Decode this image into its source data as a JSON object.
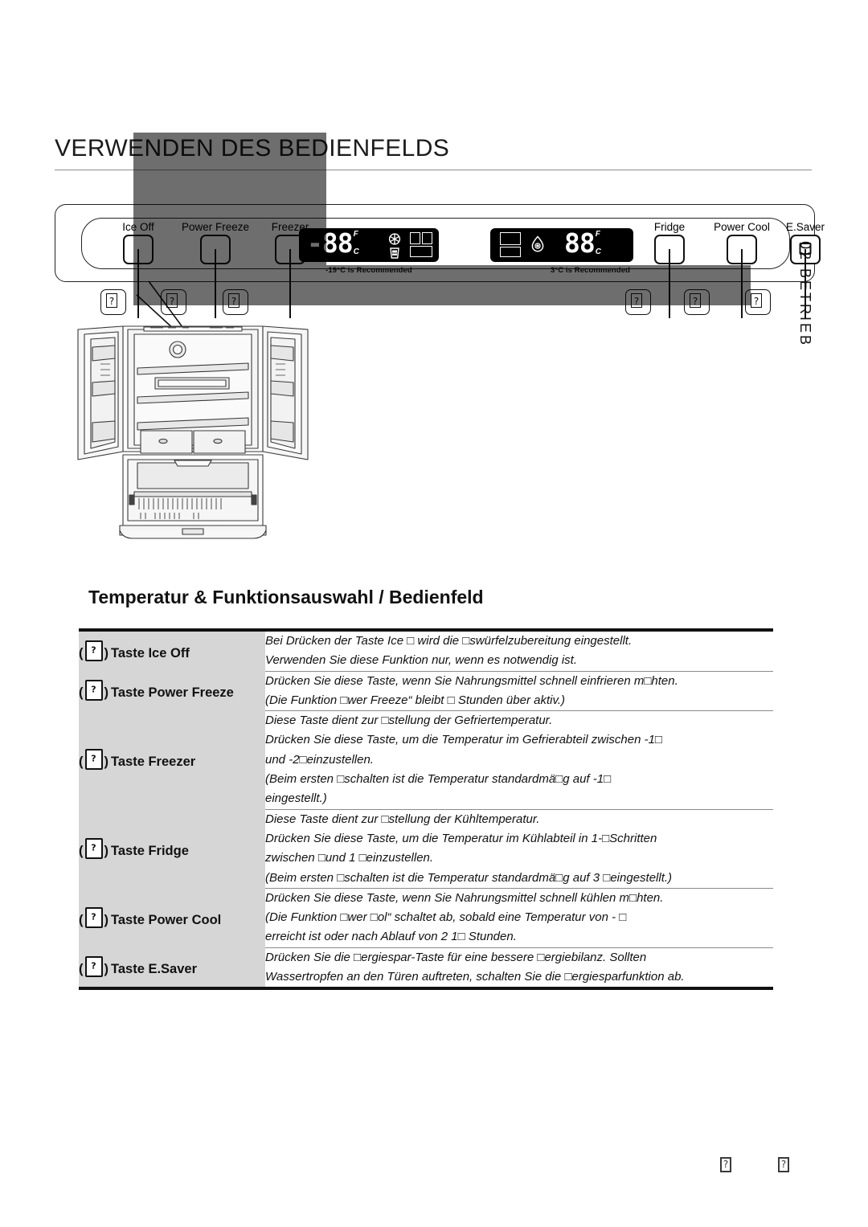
{
  "header": {
    "title": "VERWENDEN DES BEDIENFELDS"
  },
  "side_tab": {
    "number": "02",
    "label": "BETRIEB",
    "text": "02  BETRIEB"
  },
  "control_panel": {
    "left_buttons": [
      {
        "name": "ice-off",
        "label": "Ice Off"
      },
      {
        "name": "power-freeze",
        "label": "Power Freeze"
      },
      {
        "name": "freezer",
        "label": "Freezer"
      }
    ],
    "right_buttons": [
      {
        "name": "fridge",
        "label": "Fridge"
      },
      {
        "name": "power-cool",
        "label": "Power Cool"
      },
      {
        "name": "e-saver",
        "label": "E.Saver"
      }
    ],
    "freezer_display": {
      "value": "-88",
      "unit_f": "F",
      "unit_c": "C",
      "recommend": "-19°C is Recommended",
      "icons": [
        "snowflake-icon",
        "ice-off-icon",
        "compartment-icon"
      ]
    },
    "fridge_display": {
      "value": "88",
      "unit_f": "F",
      "unit_c": "C",
      "recommend": "3°C is Recommended",
      "icons": [
        "compartment-icon",
        "water-drop-icon"
      ]
    },
    "callout_glyph": "?"
  },
  "illustration": {
    "name": "french-door-refrigerator-open"
  },
  "section": {
    "heading": "Temperatur & Funktionsauswahl / Bedienfeld"
  },
  "table": {
    "glyph": "?",
    "rows": [
      {
        "key_line1": "Taste Ice Off",
        "key_line2": "",
        "lines": [
          "Bei Drücken der Taste Ice □ wird die □swürfelzubereitung eingestellt.",
          "Verwenden Sie diese Funktion nur, wenn es notwendig ist."
        ]
      },
      {
        "key_line1": "Taste Power",
        "key_line2": "Freeze",
        "lines": [
          "Drücken Sie diese Taste, wenn Sie Nahrungsmittel schnell einfrieren m□hten.",
          "(Die Funktion □wer Freeze“ bleibt □ Stunden über aktiv.)"
        ]
      },
      {
        "key_line1": "Taste Freezer",
        "key_line2": "",
        "lines": [
          "Diese Taste dient zur □stellung der Gefriertemperatur.",
          "Drücken Sie diese Taste, um die Temperatur im Gefrierabteil zwischen -1□",
          "und -2□einzustellen.",
          "(Beim ersten □schalten ist die Temperatur standardmä□g auf -1□",
          "eingestellt.)"
        ]
      },
      {
        "key_line1": "Taste Fridge",
        "key_line2": "",
        "lines": [
          "Diese Taste dient zur □stellung der Kühltemperatur.",
          "Drücken Sie diese Taste, um die Temperatur im Kühlabteil in 1-□Schritten",
          "zwischen □und 1 □einzustellen.",
          "(Beim ersten □schalten ist die Temperatur standardmä□g auf 3 □eingestellt.)"
        ]
      },
      {
        "key_line1": "Taste Power",
        "key_line2": "Cool",
        "lines": [
          "Drücken Sie diese Taste, wenn Sie Nahrungsmittel schnell kühlen m□hten.",
          "(Die Funktion □wer □ol“ schaltet ab, sobald eine Temperatur von - □",
          "erreicht ist oder nach Ablauf von 2 1□ Stunden."
        ]
      },
      {
        "key_line1": "Taste E.Saver",
        "key_line2": "",
        "lines": [
          "Drücken Sie die □ergiespar-Taste für eine bessere □ergiebilanz. Sollten",
          "Wassertropfen an den Türen auftreten, schalten Sie die □ergiesparfunktion ab."
        ]
      }
    ]
  },
  "footer": {
    "glyph_left": "?",
    "glyph_right": "?"
  },
  "colors": {
    "band_gray": "#6e6e6e",
    "key_cell_gray": "#d6d6d6",
    "rule_gray": "#8a8a8a",
    "ink": "#111111"
  }
}
